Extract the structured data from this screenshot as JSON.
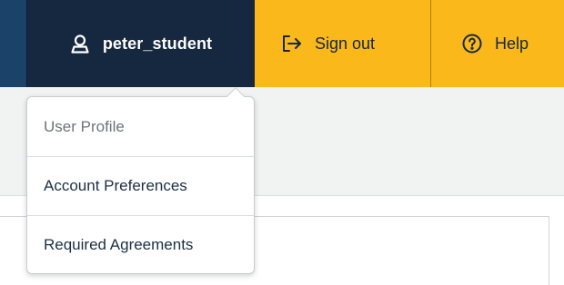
{
  "topnav": {
    "username": "peter_student",
    "signout_label": "Sign out",
    "help_label": "Help"
  },
  "user_menu": {
    "items": [
      {
        "label": "User Profile"
      },
      {
        "label": "Account Preferences"
      },
      {
        "label": "Required Agreements"
      }
    ]
  },
  "colors": {
    "nav_background": "#fbb81b",
    "user_button": "#16283f",
    "left_strip": "#1b4268",
    "text_dark": "#1d2f45"
  },
  "icons": {
    "user": "user-icon",
    "signout": "sign-out-icon",
    "help": "help-circle-icon"
  }
}
